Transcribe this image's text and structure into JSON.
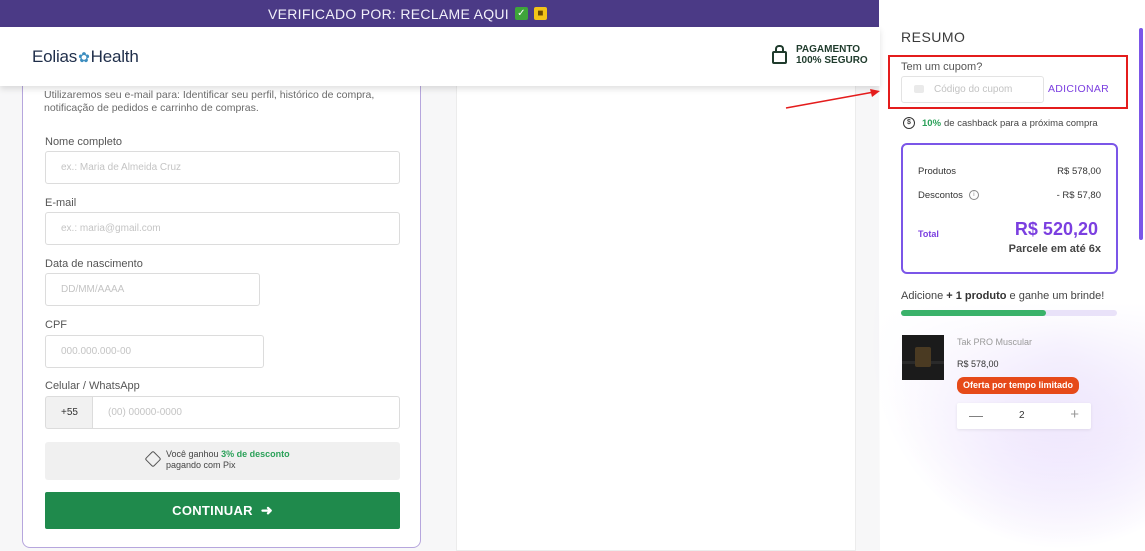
{
  "topbar": {
    "text": "VERIFICADO POR: RECLAME AQUI",
    "check_icon": "check-mark-icon",
    "lock_icon": "lock-icon"
  },
  "header": {
    "logo_left": "Eolias",
    "logo_right": "Health",
    "secure_line1": "PAGAMENTO",
    "secure_line2": "100% SEGURO"
  },
  "form": {
    "intro": "Utilizaremos seu e-mail para: Identificar seu perfil, histórico de compra, notificação de pedidos e carrinho de compras.",
    "fields": [
      {
        "label": "Nome completo",
        "placeholder": "ex.: Maria de Almeida Cruz"
      },
      {
        "label": "E-mail",
        "placeholder": "ex.: maria@gmail.com"
      },
      {
        "label": "Data de nascimento",
        "placeholder": "DD/MM/AAAA"
      },
      {
        "label": "CPF",
        "placeholder": "000.000.000-00"
      },
      {
        "label": "Celular / WhatsApp",
        "placeholder": "(00) 00000-0000",
        "prefix": "+55"
      }
    ],
    "pix": {
      "pre": "Você ganhou ",
      "discount": "3% de desconto",
      "post": "pagando com Pix"
    },
    "continue_label": "CONTINUAR"
  },
  "summary": {
    "title": "RESUMO",
    "coupon_question": "Tem um cupom?",
    "coupon_placeholder": "Código do cupom",
    "coupon_add": "ADICIONAR",
    "cashback_pct": "10%",
    "cashback_text": "de cashback para a próxima compra",
    "products_label": "Produtos",
    "products_value": "R$ 578,00",
    "discounts_label": "Descontos",
    "discounts_value": "- R$ 57,80",
    "total_label": "Total",
    "total_value": "R$ 520,20",
    "installments": "Parcele em até 6x",
    "gift_pre": "Adicione ",
    "gift_bold": "+ 1 produto",
    "gift_post": " e ganhe um brinde!",
    "gift_progress": 0.67,
    "item": {
      "name": "Tak PRO Muscular",
      "price": "R$ 578,00",
      "badge": "Oferta por tempo limitado",
      "quantity": "2"
    }
  },
  "colors": {
    "brand_purple": "#7b56e8",
    "cta_green": "#1f8a4c",
    "highlight_red": "#e41c1c",
    "topbar": "#4b3a86"
  }
}
